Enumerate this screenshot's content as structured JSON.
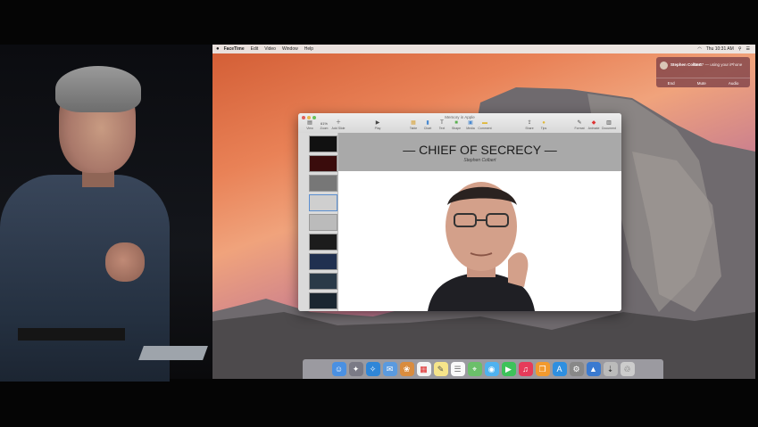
{
  "menubar": {
    "app": "FaceTime",
    "items": [
      "Edit",
      "Video",
      "Window",
      "Help"
    ],
    "clock": "Thu 10:31 AM"
  },
  "notification": {
    "caller": "Stephen Colbert",
    "status": "01:07 — using your iPhone",
    "actions": [
      "End",
      "Mute",
      "Audio"
    ]
  },
  "keynote": {
    "doc_title": "Memory in Apple",
    "toolbar": [
      {
        "label": "View",
        "icon": "view-icon"
      },
      {
        "label": "Zoom",
        "icon": "zoom-icon",
        "value": "61%"
      },
      {
        "label": "Add Slide",
        "icon": "add-slide-icon"
      },
      {
        "label": "Play",
        "icon": "play-icon"
      },
      {
        "label": "Table",
        "icon": "table-icon"
      },
      {
        "label": "Chart",
        "icon": "chart-icon"
      },
      {
        "label": "Text",
        "icon": "text-icon"
      },
      {
        "label": "Shape",
        "icon": "shape-icon"
      },
      {
        "label": "Media",
        "icon": "media-icon"
      },
      {
        "label": "Comment",
        "icon": "comment-icon"
      },
      {
        "label": "Share",
        "icon": "share-icon"
      },
      {
        "label": "Tips",
        "icon": "tips-icon"
      },
      {
        "label": "Format",
        "icon": "format-icon"
      },
      {
        "label": "Animate",
        "icon": "animate-icon"
      },
      {
        "label": "Document",
        "icon": "document-icon"
      }
    ],
    "slide": {
      "title": "— CHIEF OF SECRECY —",
      "subtitle": "Stephen Colbert"
    }
  },
  "dock": {
    "apps": [
      "finder",
      "launchpad",
      "safari",
      "mail",
      "photos",
      "calendar",
      "notes",
      "reminders",
      "maps",
      "messages",
      "facetime",
      "itunes",
      "ibooks",
      "app-store",
      "system-preferences",
      "keynote",
      "downloads",
      "trash"
    ]
  },
  "colors": {
    "accent": "#5a8ed0",
    "slide_header": "#a9a9a9"
  }
}
